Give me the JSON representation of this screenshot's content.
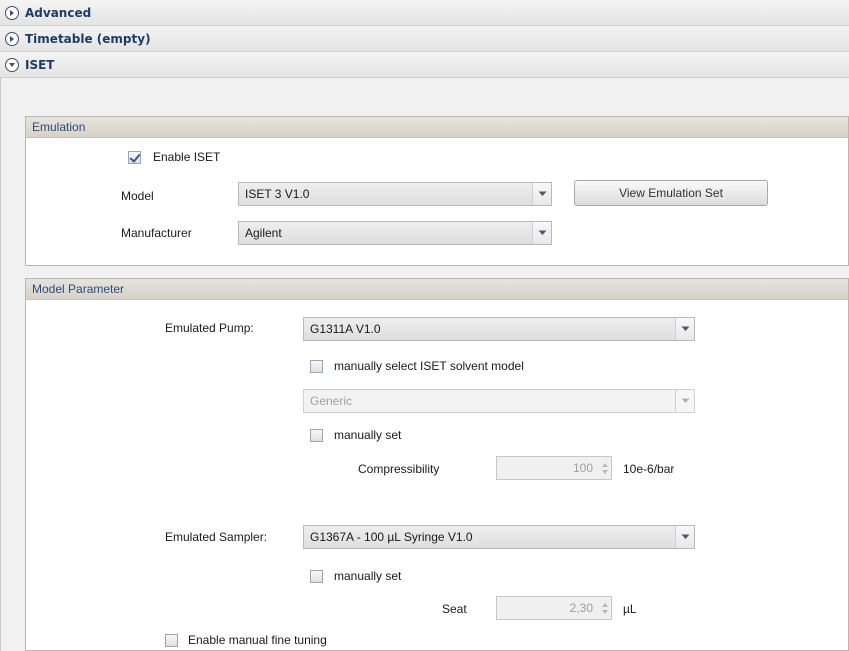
{
  "sections": {
    "advanced": {
      "label": "Advanced",
      "expanded": false
    },
    "timetable": {
      "label": "Timetable (empty)",
      "expanded": false
    },
    "iset": {
      "label": "ISET",
      "expanded": true
    }
  },
  "emulation": {
    "title": "Emulation",
    "enable_label": "Enable ISET",
    "enable_checked": true,
    "model_label": "Model",
    "model_value": "ISET 3 V1.0",
    "view_button": "View Emulation Set",
    "manufacturer_label": "Manufacturer",
    "manufacturer_value": "Agilent"
  },
  "model_parameter": {
    "title": "Model Parameter",
    "pump_label": "Emulated Pump:",
    "pump_value": "G1311A V1.0",
    "solvent_check_label": "manually select ISET solvent model",
    "solvent_checked": false,
    "solvent_value": "Generic",
    "manual_set_label": "manually set",
    "manual_set_checked": false,
    "compressibility_label": "Compressibility",
    "compressibility_value": "100",
    "compressibility_unit": "10e-6/bar",
    "sampler_label": "Emulated Sampler:",
    "sampler_value": "G1367A - 100 µL Syringe V1.0",
    "sampler_manual_label": "manually set",
    "sampler_manual_checked": false,
    "seat_label": "Seat",
    "seat_value": "2,30",
    "seat_unit": "µL",
    "fine_tuning_label": "Enable manual fine tuning",
    "fine_tuning_checked": false
  },
  "colors": {
    "header_text": "#1f3b66",
    "group_title": "#2e4c78"
  },
  "icons": {
    "collapsed": "circle-chevron-right-icon",
    "expanded": "circle-chevron-down-icon",
    "dropdown": "chevron-down-icon"
  }
}
